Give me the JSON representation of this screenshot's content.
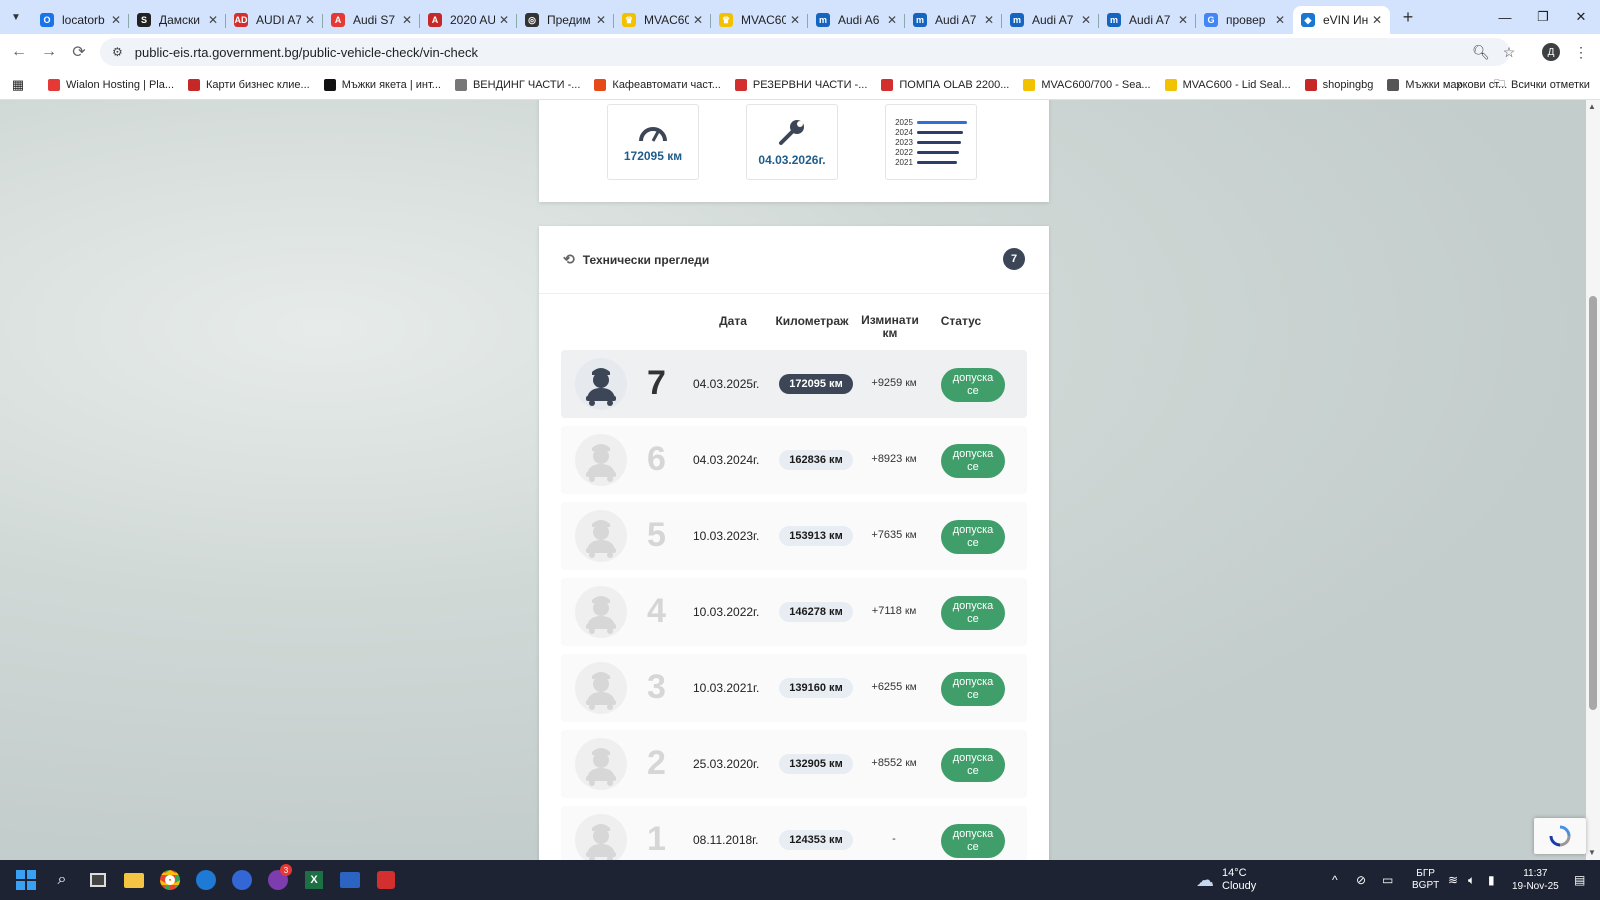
{
  "browser": {
    "tabs": [
      {
        "title": "locatorb",
        "fav_color": "#1a73e8",
        "fav_text": "O"
      },
      {
        "title": "Дамски",
        "fav_color": "#222222",
        "fav_text": "S"
      },
      {
        "title": "AUDI A7",
        "fav_color": "#d32f2f",
        "fav_text": "AD"
      },
      {
        "title": "Audi S7",
        "fav_color": "#e53935",
        "fav_text": "A"
      },
      {
        "title": "2020 AU",
        "fav_color": "#c62828",
        "fav_text": "A"
      },
      {
        "title": "Предим",
        "fav_color": "#333333",
        "fav_text": "◎"
      },
      {
        "title": "MVAC60",
        "fav_color": "#f2c200",
        "fav_text": "♛"
      },
      {
        "title": "MVAC60",
        "fav_color": "#f2c200",
        "fav_text": "♛"
      },
      {
        "title": "Audi A6",
        "fav_color": "#1565c0",
        "fav_text": "m"
      },
      {
        "title": "Audi A7",
        "fav_color": "#1565c0",
        "fav_text": "m"
      },
      {
        "title": "Audi A7",
        "fav_color": "#1565c0",
        "fav_text": "m"
      },
      {
        "title": "Audi A7",
        "fav_color": "#1565c0",
        "fav_text": "m"
      },
      {
        "title": "провер",
        "fav_color": "#4285f4",
        "fav_text": "G"
      },
      {
        "title": "eVIN Ин",
        "fav_color": "#1976d2",
        "fav_text": "◆"
      }
    ],
    "url": "public-eis.rta.government.bg/public-vehicle-check/vin-check",
    "profile_initial": "Д",
    "bookmarks": [
      {
        "label": "Wialon Hosting | Pla...",
        "color": "#e53935"
      },
      {
        "label": "Карти бизнес клие...",
        "color": "#c62828"
      },
      {
        "label": "Мъжки якета | инт...",
        "color": "#111111"
      },
      {
        "label": "ВЕНДИНГ ЧАСТИ -...",
        "color": "#777777"
      },
      {
        "label": "Кафеавтомати част...",
        "color": "#e64a19"
      },
      {
        "label": "РЕЗЕРВНИ ЧАСТИ -...",
        "color": "#d32f2f"
      },
      {
        "label": "ПОМПА OLAB 2200...",
        "color": "#d32f2f"
      },
      {
        "label": "MVAC600/700 - Sea...",
        "color": "#f2c200"
      },
      {
        "label": "MVAC600 - Lid Seal...",
        "color": "#f2c200"
      },
      {
        "label": "shopingbg",
        "color": "#c62828"
      },
      {
        "label": "Мъжки маркови ст...",
        "color": "#555555"
      }
    ],
    "all_bookmarks": "Всички отметки"
  },
  "summary": {
    "mileage": "172095 км",
    "next_inspection": "04.03.2026г.",
    "years": [
      "2025",
      "2024",
      "2023",
      "2022",
      "2021"
    ]
  },
  "inspections": {
    "title": "Технически прегледи",
    "count": "7",
    "columns": {
      "date": "Дата",
      "mileage": "Километраж",
      "diff_line1": "Изминати",
      "diff_line2": "км",
      "status": "Статус"
    },
    "rows": [
      {
        "num": "7",
        "date": "04.03.2025г.",
        "km": "172095 км",
        "delta": "+9259",
        "status_l1": "допуска",
        "status_l2": "се"
      },
      {
        "num": "6",
        "date": "04.03.2024г.",
        "km": "162836 км",
        "delta": "+8923",
        "status_l1": "допуска",
        "status_l2": "се"
      },
      {
        "num": "5",
        "date": "10.03.2023г.",
        "km": "153913 км",
        "delta": "+7635",
        "status_l1": "допуска",
        "status_l2": "се"
      },
      {
        "num": "4",
        "date": "10.03.2022г.",
        "km": "146278 км",
        "delta": "+7118",
        "status_l1": "допуска",
        "status_l2": "се"
      },
      {
        "num": "3",
        "date": "10.03.2021г.",
        "km": "139160 км",
        "delta": "+6255",
        "status_l1": "допуска",
        "status_l2": "се"
      },
      {
        "num": "2",
        "date": "25.03.2020г.",
        "km": "132905 км",
        "delta": "+8552",
        "status_l1": "допуска",
        "status_l2": "се"
      },
      {
        "num": "1",
        "date": "08.11.2018г.",
        "km": "124353 км",
        "delta": "-",
        "status_l1": "допуска",
        "status_l2": "се"
      }
    ],
    "delta_unit": "км"
  },
  "taskbar": {
    "weather_temp": "14°C",
    "weather_text": "Cloudy",
    "lang_line1": "БГР",
    "lang_line2": "BGPT",
    "time": "11:37",
    "date": "19-Nov-25",
    "viber_badge": "3"
  },
  "colors": {
    "accent": "#1f5d8a",
    "status_green": "#3f9e6a",
    "badge_dark": "#3c4656"
  }
}
